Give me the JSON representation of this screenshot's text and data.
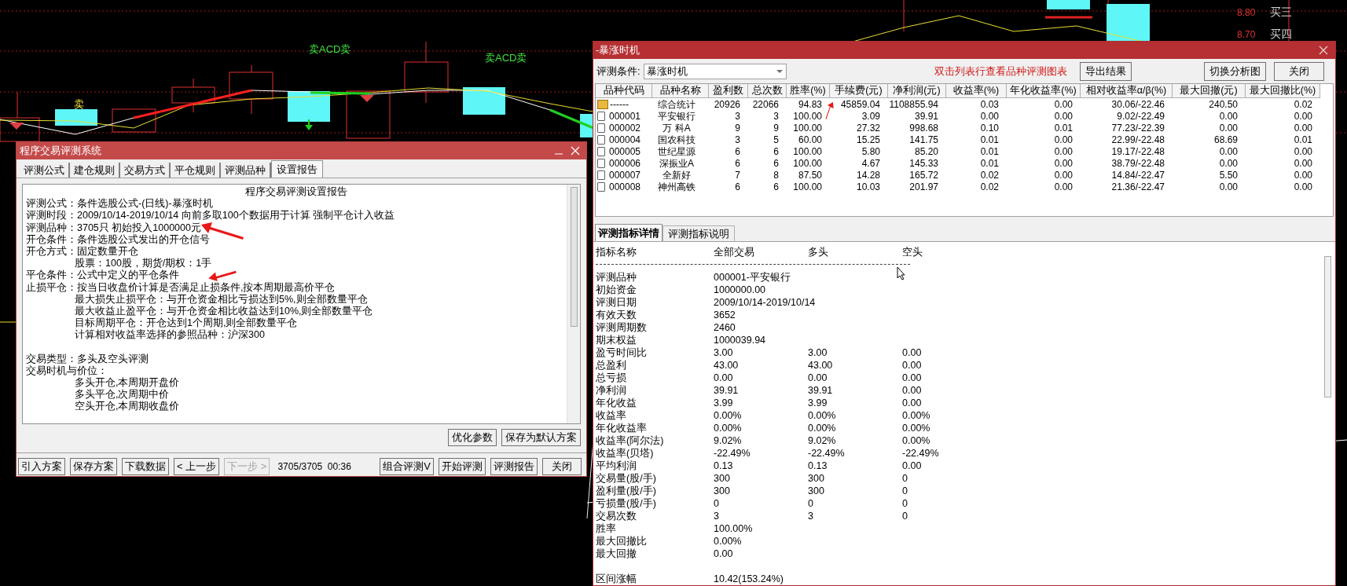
{
  "chart": {
    "labels": [
      {
        "text": "卖",
        "kind": "sell"
      },
      {
        "text": "卖ACD卖",
        "kind": "signal"
      },
      {
        "text": "卖ACD卖",
        "kind": "signal"
      },
      {
        "text": "8.80",
        "kind": "price"
      },
      {
        "text": "买三",
        "kind": "order"
      },
      {
        "text": "8.70",
        "kind": "price"
      },
      {
        "text": "买四",
        "kind": "order"
      }
    ]
  },
  "test_window": {
    "title": "程序交易评测系统",
    "tabs": [
      {
        "label": "评测公式",
        "selected": false
      },
      {
        "label": "建仓规则",
        "selected": false
      },
      {
        "label": "交易方式",
        "selected": false
      },
      {
        "label": "平仓规则",
        "selected": false
      },
      {
        "label": "评测品种",
        "selected": false
      },
      {
        "label": "设置报告",
        "selected": true
      }
    ],
    "report": {
      "heading": "程序交易评测设置报告",
      "lines": [
        {
          "kind": "item",
          "text": "评测公式：条件选股公式-(日线)-暴涨时机"
        },
        {
          "kind": "item",
          "text": "评测时段：2009/10/14-2019/10/14 向前多取100个数据用于计算 强制平仓计入收益"
        },
        {
          "kind": "item",
          "text": "评测品种：3705只 初始投入1000000元"
        },
        {
          "kind": "item",
          "text": "开仓条件：条件选股公式发出的开仓信号"
        },
        {
          "kind": "item",
          "text": "开仓方式：固定数量开仓"
        },
        {
          "kind": "sub",
          "text": "股票：100股，期货/期权：1手"
        },
        {
          "kind": "item",
          "text": "平仓条件：公式中定义的平仓条件"
        },
        {
          "kind": "item",
          "text": "止损平仓：按当日收盘价计算是否满足止损条件,按本周期最高价平仓"
        },
        {
          "kind": "sub",
          "text": "最大损失止损平仓：与开仓资金相比亏损达到5%,则全部数量平仓"
        },
        {
          "kind": "sub",
          "text": "最大收益止盈平仓：与开仓资金相比收益达到10%,则全部数量平仓"
        },
        {
          "kind": "sub",
          "text": "目标周期平仓：开仓达到1个周期,则全部数量平仓"
        },
        {
          "kind": "sub",
          "text": "计算相对收益率选择的参照品种：沪深300"
        },
        {
          "kind": "section",
          "text": "交易类型：多头及空头评测"
        },
        {
          "kind": "item",
          "text": "交易时机与价位："
        },
        {
          "kind": "sub",
          "text": "多头开仓,本周期开盘价"
        },
        {
          "kind": "sub",
          "text": "多头平仓,次周期中价"
        },
        {
          "kind": "sub",
          "text": "空头开仓,本周期收盘价"
        }
      ]
    },
    "side_buttons": [
      "优化参数",
      "保存为默认方案"
    ],
    "bottom_buttons": [
      {
        "label": "引入方案",
        "disabled": false
      },
      {
        "label": "保存方案",
        "disabled": false
      },
      {
        "label": "下载数据",
        "disabled": false
      },
      {
        "label": "< 上一步",
        "disabled": false
      },
      {
        "label": "下一步 >",
        "disabled": true
      }
    ],
    "progress": "3705/3705  00:36",
    "right_buttons": [
      "组合评测V",
      "开始评测",
      "评测报告",
      "关闭"
    ]
  },
  "result_window": {
    "title": "-暴涨时机",
    "condition_label": "评测条件:",
    "condition_value": "暴涨时机",
    "hint": "双击列表行查看品种评测图表",
    "buttons": [
      "导出结果",
      "切换分析图",
      "关闭"
    ],
    "table": {
      "columns": [
        "品种代码",
        "品种名称",
        "盈利数",
        "总次数",
        "胜率(%)",
        "手续费(元)",
        "净利润(元)",
        "收益率(%)",
        "年化收益率(%)",
        "相对收益率α/β(%)",
        "最大回撤(元)",
        "最大回撤比(%)"
      ],
      "rows": [
        {
          "kind": "summary",
          "cells": [
            "------",
            "综合统计",
            "20926",
            "22066",
            "94.83",
            "45859.04",
            "1108855.94",
            "0.03",
            "0.00",
            "30.06/-22.46",
            "240.50",
            "0.02"
          ]
        },
        {
          "kind": "stock",
          "cells": [
            "000001",
            "平安银行",
            "3",
            "3",
            "100.00",
            "3.09",
            "39.91",
            "0.00",
            "0.00",
            "9.02/-22.49",
            "0.00",
            "0.00"
          ]
        },
        {
          "kind": "stock",
          "cells": [
            "000002",
            "万 科A",
            "9",
            "9",
            "100.00",
            "27.32",
            "998.68",
            "0.10",
            "0.01",
            "77.23/-22.39",
            "0.00",
            "0.00"
          ]
        },
        {
          "kind": "stock",
          "cells": [
            "000004",
            "国农科技",
            "3",
            "5",
            "60.00",
            "15.25",
            "141.75",
            "0.01",
            "0.00",
            "22.99/-22.48",
            "68.69",
            "0.01"
          ]
        },
        {
          "kind": "stock",
          "cells": [
            "000005",
            "世纪星源",
            "6",
            "6",
            "100.00",
            "5.80",
            "85.20",
            "0.01",
            "0.00",
            "19.17/-22.48",
            "0.00",
            "0.00"
          ]
        },
        {
          "kind": "stock",
          "cells": [
            "000006",
            "深振业A",
            "6",
            "6",
            "100.00",
            "4.67",
            "145.33",
            "0.01",
            "0.00",
            "38.79/-22.48",
            "0.00",
            "0.00"
          ]
        },
        {
          "kind": "stock",
          "cells": [
            "000007",
            "全新好",
            "7",
            "8",
            "87.50",
            "14.28",
            "165.72",
            "0.02",
            "0.00",
            "14.84/-22.47",
            "5.50",
            "0.00"
          ]
        },
        {
          "kind": "stock",
          "cells": [
            "000008",
            "神州高铁",
            "6",
            "6",
            "100.00",
            "10.03",
            "201.97",
            "0.02",
            "0.00",
            "21.36/-22.47",
            "0.00",
            "0.00"
          ]
        }
      ]
    },
    "detail": {
      "tabs": [
        {
          "label": "评测指标详情",
          "selected": true
        },
        {
          "label": "评测指标说明",
          "selected": false
        }
      ],
      "columns": [
        "指标名称",
        "全部交易",
        "多头",
        "空头"
      ],
      "rows": [
        {
          "name": "评测品种",
          "values": [
            "000001-平安银行"
          ]
        },
        {
          "name": "初始资金",
          "values": [
            "1000000.00"
          ]
        },
        {
          "name": "评测日期",
          "values": [
            "2009/10/14-2019/10/14"
          ]
        },
        {
          "name": "有效天数",
          "values": [
            "3652"
          ]
        },
        {
          "name": "评测周期数",
          "values": [
            "2460"
          ]
        },
        {
          "name": "期末权益",
          "values": [
            "1000039.94"
          ]
        },
        {
          "name": "盈亏时间比",
          "values": [
            "3.00",
            "3.00",
            "0.00"
          ]
        },
        {
          "name": "总盈利",
          "values": [
            "43.00",
            "43.00",
            "0.00"
          ]
        },
        {
          "name": "总亏损",
          "values": [
            "0.00",
            "0.00",
            "0.00"
          ]
        },
        {
          "name": "净利润",
          "values": [
            "39.91",
            "39.91",
            "0.00"
          ]
        },
        {
          "name": "年化收益",
          "values": [
            "3.99",
            "3.99",
            "0.00"
          ]
        },
        {
          "name": "收益率",
          "values": [
            "0.00%",
            "0.00%",
            "0.00%"
          ]
        },
        {
          "name": "年化收益率",
          "values": [
            "0.00%",
            "0.00%",
            "0.00%"
          ]
        },
        {
          "name": "收益率(阿尔法)",
          "values": [
            "9.02%",
            "9.02%",
            "0.00%"
          ]
        },
        {
          "name": "收益率(贝塔)",
          "values": [
            "-22.49%",
            "-22.49%",
            "-22.49%"
          ]
        },
        {
          "name": "平均利润",
          "values": [
            "0.13",
            "0.13",
            "0.00"
          ]
        },
        {
          "name": "交易量(股/手)",
          "values": [
            "300",
            "300",
            "0"
          ]
        },
        {
          "name": "盈利量(股/手)",
          "values": [
            "300",
            "300",
            "0"
          ]
        },
        {
          "name": "亏损量(股/手)",
          "values": [
            "0",
            "0",
            "0"
          ]
        },
        {
          "name": "交易次数",
          "values": [
            "3",
            "3",
            "0"
          ]
        },
        {
          "name": "胜率",
          "values": [
            "100.00%"
          ]
        },
        {
          "name": "最大回撤比",
          "values": [
            "0.00%"
          ]
        },
        {
          "name": "最大回撤",
          "values": [
            "0.00"
          ]
        }
      ],
      "footer": [
        {
          "name": "区间涨幅",
          "values": [
            "10.42(153.24%)"
          ]
        }
      ]
    }
  }
}
